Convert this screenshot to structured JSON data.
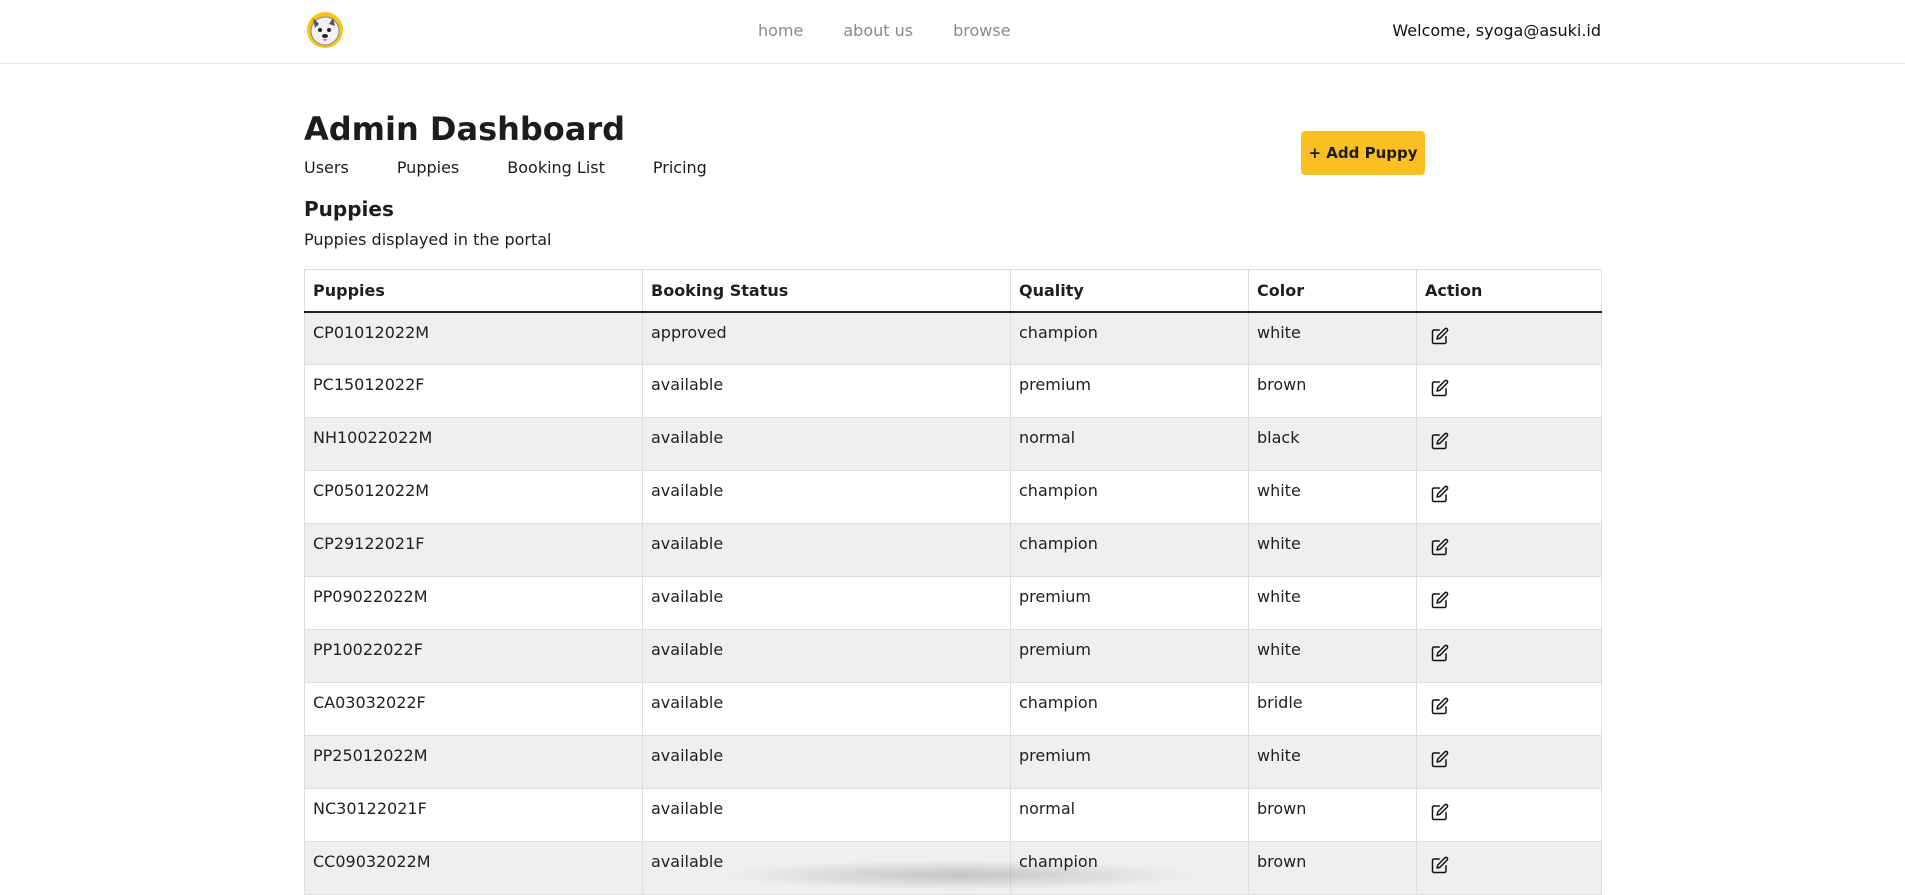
{
  "header": {
    "logo_alt": "puppy logo",
    "nav": [
      {
        "label": "home"
      },
      {
        "label": "about us"
      },
      {
        "label": "browse"
      }
    ],
    "welcome": "Welcome, syoga@asuki.id"
  },
  "page": {
    "title": "Admin Dashboard",
    "tabs": [
      {
        "label": "Users"
      },
      {
        "label": "Puppies"
      },
      {
        "label": "Booking List"
      },
      {
        "label": "Pricing"
      }
    ],
    "add_button": "+ Add Puppy",
    "section_title": "Puppies",
    "section_subtitle": "Puppies displayed in the portal"
  },
  "table": {
    "columns": [
      "Puppies",
      "Booking Status",
      "Quality",
      "Color",
      "Action"
    ],
    "rows": [
      [
        "CP01012022M",
        "approved",
        "champion",
        "white"
      ],
      [
        "PC15012022F",
        "available",
        "premium",
        "brown"
      ],
      [
        "NH10022022M",
        "available",
        "normal",
        "black"
      ],
      [
        "CP05012022M",
        "available",
        "champion",
        "white"
      ],
      [
        "CP29122021F",
        "available",
        "champion",
        "white"
      ],
      [
        "PP09022022M",
        "available",
        "premium",
        "white"
      ],
      [
        "PP10022022F",
        "available",
        "premium",
        "white"
      ],
      [
        "CA03032022F",
        "available",
        "champion",
        "bridle"
      ],
      [
        "PP25012022M",
        "available",
        "premium",
        "white"
      ],
      [
        "NC30122021F",
        "available",
        "normal",
        "brown"
      ],
      [
        "CC09032022M",
        "available",
        "champion",
        "brown"
      ]
    ],
    "action_icon": "edit-icon"
  },
  "colors": {
    "accent": "#fbbf24",
    "row_stripe": "#efefef",
    "nav_text": "#8a8a8a"
  }
}
